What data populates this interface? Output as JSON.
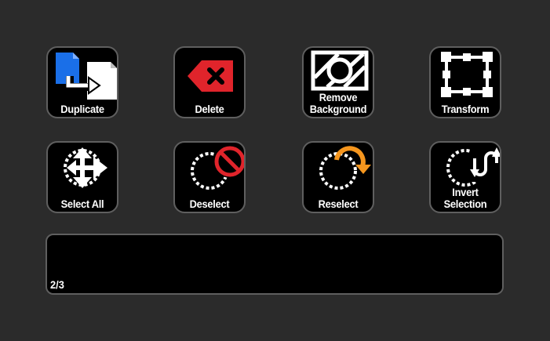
{
  "buttons": [
    {
      "name": "duplicate-button",
      "label1": "Duplicate",
      "label2": "",
      "icon": "duplicate-icon"
    },
    {
      "name": "delete-button",
      "label1": "Delete",
      "label2": "",
      "icon": "delete-icon"
    },
    {
      "name": "remove-background-button",
      "label1": "Remove",
      "label2": "Background",
      "icon": "remove-background-icon"
    },
    {
      "name": "transform-button",
      "label1": "Transform",
      "label2": "",
      "icon": "transform-icon"
    },
    {
      "name": "select-all-button",
      "label1": "Select All",
      "label2": "",
      "icon": "select-all-icon"
    },
    {
      "name": "deselect-button",
      "label1": "Deselect",
      "label2": "",
      "icon": "deselect-icon"
    },
    {
      "name": "reselect-button",
      "label1": "Reselect",
      "label2": "",
      "icon": "reselect-icon"
    },
    {
      "name": "invert-selection-button",
      "label1": "Invert",
      "label2": "Selection",
      "icon": "invert-selection-icon"
    }
  ],
  "strip": {
    "page_indicator": "2/3"
  },
  "colors": {
    "background": "#2b2b2b",
    "key_fill": "#000000",
    "key_border": "#5f5f5f",
    "accent_blue": "#1a6fe8",
    "accent_red": "#e0242b",
    "accent_orange": "#f5961e"
  }
}
